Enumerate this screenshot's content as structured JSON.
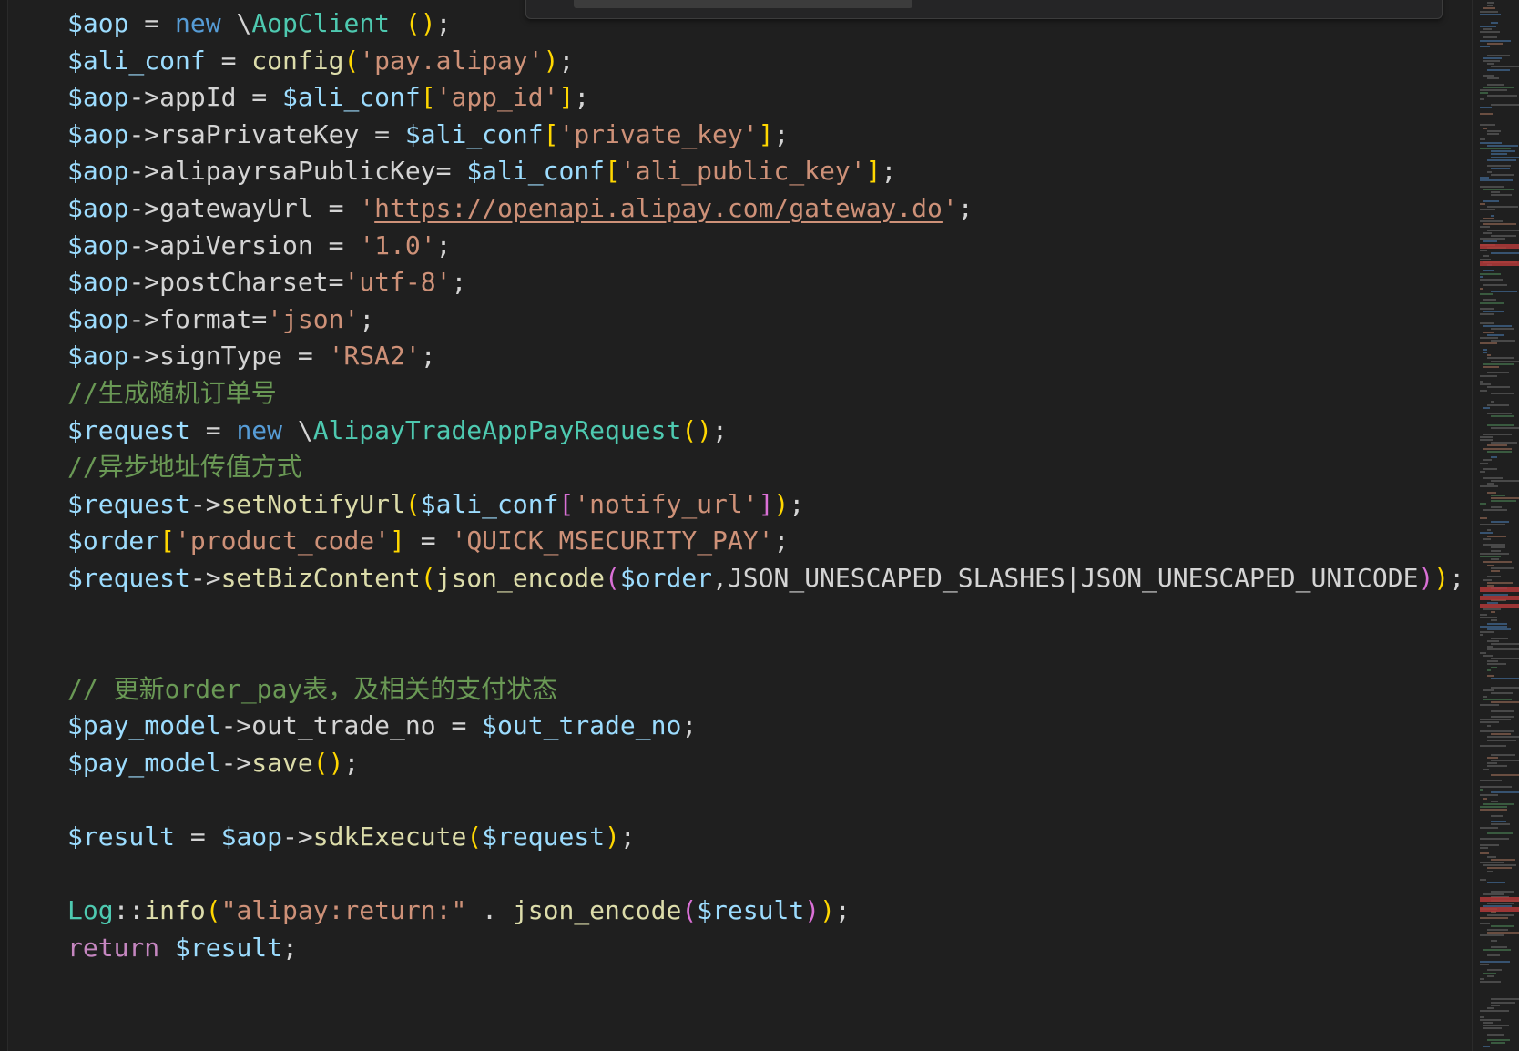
{
  "editor": {
    "lines": [
      [
        [
          "c-var",
          "$aop"
        ],
        [
          "c-op",
          " = "
        ],
        [
          "c-kw",
          "new"
        ],
        [
          "c-op",
          " \\"
        ],
        [
          "c-cls",
          "AopClient"
        ],
        [
          "c-op",
          " "
        ],
        [
          "c-b1",
          "()"
        ],
        [
          "c-op",
          ";"
        ]
      ],
      [
        [
          "c-var",
          "$ali_conf"
        ],
        [
          "c-op",
          " = "
        ],
        [
          "c-fn",
          "config"
        ],
        [
          "c-b1",
          "("
        ],
        [
          "c-str",
          "'pay.alipay'"
        ],
        [
          "c-b1",
          ")"
        ],
        [
          "c-op",
          ";"
        ]
      ],
      [
        [
          "c-var",
          "$aop"
        ],
        [
          "c-op",
          "->"
        ],
        [
          "c-prop",
          "appId"
        ],
        [
          "c-op",
          " = "
        ],
        [
          "c-var",
          "$ali_conf"
        ],
        [
          "c-b1",
          "["
        ],
        [
          "c-str",
          "'app_id'"
        ],
        [
          "c-b1",
          "]"
        ],
        [
          "c-op",
          ";"
        ]
      ],
      [
        [
          "c-var",
          "$aop"
        ],
        [
          "c-op",
          "->"
        ],
        [
          "c-prop",
          "rsaPrivateKey"
        ],
        [
          "c-op",
          " = "
        ],
        [
          "c-var",
          "$ali_conf"
        ],
        [
          "c-b1",
          "["
        ],
        [
          "c-str",
          "'private_key'"
        ],
        [
          "c-b1",
          "]"
        ],
        [
          "c-op",
          ";"
        ]
      ],
      [
        [
          "c-var",
          "$aop"
        ],
        [
          "c-op",
          "->"
        ],
        [
          "c-prop",
          "alipayrsaPublicKey"
        ],
        [
          "c-op",
          "= "
        ],
        [
          "c-var",
          "$ali_conf"
        ],
        [
          "c-b1",
          "["
        ],
        [
          "c-str",
          "'ali_public_key'"
        ],
        [
          "c-b1",
          "]"
        ],
        [
          "c-op",
          ";"
        ]
      ],
      [
        [
          "c-var",
          "$aop"
        ],
        [
          "c-op",
          "->"
        ],
        [
          "c-prop",
          "gatewayUrl"
        ],
        [
          "c-op",
          " = "
        ],
        [
          "c-str",
          "'"
        ],
        [
          "c-url",
          "https://openapi.alipay.com/gateway.do"
        ],
        [
          "c-str",
          "'"
        ],
        [
          "c-op",
          ";"
        ]
      ],
      [
        [
          "c-var",
          "$aop"
        ],
        [
          "c-op",
          "->"
        ],
        [
          "c-prop",
          "apiVersion"
        ],
        [
          "c-op",
          " = "
        ],
        [
          "c-str",
          "'1.0'"
        ],
        [
          "c-op",
          ";"
        ]
      ],
      [
        [
          "c-var",
          "$aop"
        ],
        [
          "c-op",
          "->"
        ],
        [
          "c-prop",
          "postCharset"
        ],
        [
          "c-op",
          "="
        ],
        [
          "c-str",
          "'utf-8'"
        ],
        [
          "c-op",
          ";"
        ]
      ],
      [
        [
          "c-var",
          "$aop"
        ],
        [
          "c-op",
          "->"
        ],
        [
          "c-prop",
          "format"
        ],
        [
          "c-op",
          "="
        ],
        [
          "c-str",
          "'json'"
        ],
        [
          "c-op",
          ";"
        ]
      ],
      [
        [
          "c-var",
          "$aop"
        ],
        [
          "c-op",
          "->"
        ],
        [
          "c-prop",
          "signType"
        ],
        [
          "c-op",
          " = "
        ],
        [
          "c-str",
          "'RSA2'"
        ],
        [
          "c-op",
          ";"
        ]
      ],
      [
        [
          "c-cmt",
          "//生成随机订单号"
        ]
      ],
      [
        [
          "c-var",
          "$request"
        ],
        [
          "c-op",
          " = "
        ],
        [
          "c-kw",
          "new"
        ],
        [
          "c-op",
          " \\"
        ],
        [
          "c-cls",
          "AlipayTradeAppPayRequest"
        ],
        [
          "c-b1",
          "()"
        ],
        [
          "c-op",
          ";"
        ]
      ],
      [
        [
          "c-cmt",
          "//异步地址传值方式"
        ]
      ],
      [
        [
          "c-var",
          "$request"
        ],
        [
          "c-op",
          "->"
        ],
        [
          "c-fn",
          "setNotifyUrl"
        ],
        [
          "c-b1",
          "("
        ],
        [
          "c-var",
          "$ali_conf"
        ],
        [
          "c-b2",
          "["
        ],
        [
          "c-str",
          "'notify_url'"
        ],
        [
          "c-b2",
          "]"
        ],
        [
          "c-b1",
          ")"
        ],
        [
          "c-op",
          ";"
        ]
      ],
      [
        [
          "c-var",
          "$order"
        ],
        [
          "c-b1",
          "["
        ],
        [
          "c-str",
          "'product_code'"
        ],
        [
          "c-b1",
          "]"
        ],
        [
          "c-op",
          " = "
        ],
        [
          "c-str",
          "'QUICK_MSECURITY_PAY'"
        ],
        [
          "c-op",
          ";"
        ]
      ],
      [
        [
          "c-var",
          "$request"
        ],
        [
          "c-op",
          "->"
        ],
        [
          "c-fn",
          "setBizContent"
        ],
        [
          "c-b1",
          "("
        ],
        [
          "c-fn",
          "json_encode"
        ],
        [
          "c-b2",
          "("
        ],
        [
          "c-var",
          "$order"
        ],
        [
          "c-op",
          ",JSON_UNESCAPED_SLASHES|JSON_UNESCAPED_UNICODE"
        ],
        [
          "c-b2",
          ")"
        ],
        [
          "c-b1",
          ")"
        ],
        [
          "c-op",
          ";"
        ]
      ],
      [],
      [],
      [
        [
          "c-cmt",
          "// 更新order_pay表，及相关的支付状态"
        ]
      ],
      [
        [
          "c-var",
          "$pay_model"
        ],
        [
          "c-op",
          "->"
        ],
        [
          "c-prop",
          "out_trade_no"
        ],
        [
          "c-op",
          " = "
        ],
        [
          "c-var",
          "$out_trade_no"
        ],
        [
          "c-op",
          ";"
        ]
      ],
      [
        [
          "c-var",
          "$pay_model"
        ],
        [
          "c-op",
          "->"
        ],
        [
          "c-fn",
          "save"
        ],
        [
          "c-b1",
          "()"
        ],
        [
          "c-op",
          ";"
        ]
      ],
      [],
      [
        [
          "c-var",
          "$result"
        ],
        [
          "c-op",
          " = "
        ],
        [
          "c-var",
          "$aop"
        ],
        [
          "c-op",
          "->"
        ],
        [
          "c-fn",
          "sdkExecute"
        ],
        [
          "c-b1",
          "("
        ],
        [
          "c-var",
          "$request"
        ],
        [
          "c-b1",
          ")"
        ],
        [
          "c-op",
          ";"
        ]
      ],
      [],
      [
        [
          "c-cls",
          "Log"
        ],
        [
          "c-op",
          "::"
        ],
        [
          "c-fn",
          "info"
        ],
        [
          "c-b1",
          "("
        ],
        [
          "c-str",
          "\"alipay:return:\""
        ],
        [
          "c-op",
          " . "
        ],
        [
          "c-fn",
          "json_encode"
        ],
        [
          "c-b2",
          "("
        ],
        [
          "c-var",
          "$result"
        ],
        [
          "c-b2",
          ")"
        ],
        [
          "c-b1",
          ")"
        ],
        [
          "c-op",
          ";"
        ]
      ],
      [
        [
          "c-ctrl",
          "return"
        ],
        [
          "c-op",
          " "
        ],
        [
          "c-var",
          "$result"
        ],
        [
          "c-op",
          ";"
        ]
      ]
    ]
  },
  "colors": {
    "background": "#1f1f1f",
    "variable": "#9cdcfe",
    "function": "#dcdcaa",
    "class": "#4ec9b0",
    "keyword": "#569cd6",
    "string": "#ce9178",
    "comment": "#6a9955",
    "bracket_gold": "#ffd700",
    "bracket_purple": "#da70d6",
    "error_marker": "#b13a3a"
  },
  "icons": {
    "find_widget": "find-replace-widget",
    "minimap": "minimap-overview"
  }
}
